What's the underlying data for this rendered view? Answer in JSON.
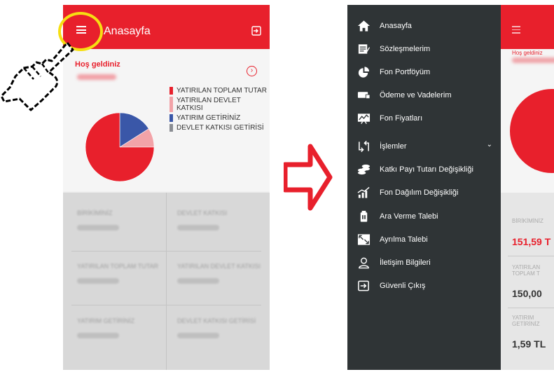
{
  "left_screen": {
    "title": "Anasayfa",
    "welcome": "Hoş geldiniz",
    "chart_data": {
      "type": "pie",
      "categories": [
        "YATIRILAN TOPLAM TUTAR",
        "YATIRILAN DEVLET KATKISI",
        "YATIRIM GETİRİNİZ",
        "DEVLET KATKISI GETİRİSİ"
      ],
      "values": [
        75,
        9,
        16,
        0
      ],
      "colors": [
        "#e8202c",
        "#f2a3a8",
        "#3a57a8",
        "#8a8d93"
      ]
    },
    "legend": [
      {
        "label": "YATIRILAN TOPLAM TUTAR",
        "color": "#e8202c"
      },
      {
        "label": "YATIRILAN DEVLET KATKISI",
        "color": "#f2a3a8"
      },
      {
        "label": "YATIRIM GETİRİNİZ",
        "color": "#3a57a8"
      },
      {
        "label": "DEVLET KATKISI GETİRİSİ",
        "color": "#8a8d93"
      }
    ],
    "stats": [
      "BİRİKİMİNİZ",
      "DEVLET KATKISI",
      "YATIRILAN TOPLAM TUTAR",
      "YATIRILAN DEVLET KATKISI",
      "YATIRIM GETİRİNİZ",
      "DEVLET KATKISI GETİRİSİ"
    ]
  },
  "menu": [
    {
      "label": "Anasayfa",
      "icon": "home-icon"
    },
    {
      "label": "Sözleşmelerim",
      "icon": "contract-icon"
    },
    {
      "label": "Fon Portföyüm",
      "icon": "portfolio-pie-icon"
    },
    {
      "label": "Ödeme ve Vadelerim",
      "icon": "payment-icon"
    },
    {
      "label": "Fon Fiyatları",
      "icon": "price-chart-icon"
    },
    {
      "label": "İşlemler",
      "icon": "transactions-icon"
    },
    {
      "label": "Katkı Payı Tutarı Değişikliği",
      "icon": "coins-icon"
    },
    {
      "label": "Fon Dağılım Değişikliği",
      "icon": "distribution-icon"
    },
    {
      "label": "Ara Verme Talebi",
      "icon": "pause-icon"
    },
    {
      "label": "Ayrılma Talebi",
      "icon": "leave-icon"
    },
    {
      "label": "İletişim Bilgileri",
      "icon": "contact-icon"
    },
    {
      "label": "Güvenli Çıkış",
      "icon": "logout-icon"
    }
  ],
  "peek": {
    "welcome": "Hoş geldiniz",
    "labels": [
      "BİRİKİMİNİZ",
      "YATIRILAN TOPLAM T",
      "YATIRIM GETİRİNİZ"
    ],
    "values": [
      "151,59 T",
      "150,00",
      "1,59 TL"
    ]
  }
}
